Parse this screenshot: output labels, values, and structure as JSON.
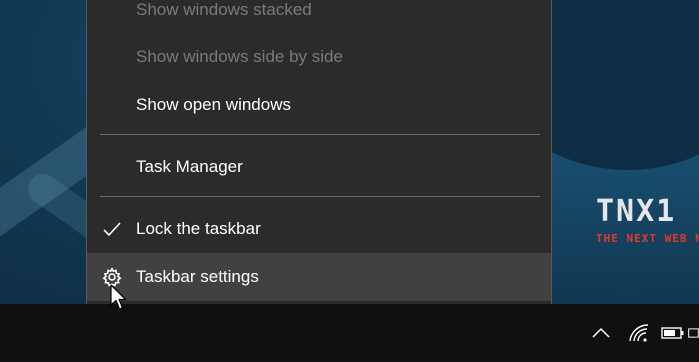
{
  "context_menu": {
    "items": [
      {
        "label": "Show windows stacked",
        "enabled": false
      },
      {
        "label": "Show windows side by side",
        "enabled": false
      },
      {
        "label": "Show open windows",
        "enabled": true
      },
      {
        "label": "Task Manager",
        "enabled": true
      },
      {
        "label": "Lock the taskbar",
        "enabled": true,
        "checked": true,
        "icon": "checkmark-icon"
      },
      {
        "label": "Taskbar settings",
        "enabled": true,
        "icon": "gear-icon",
        "hovered": true
      }
    ]
  },
  "wallpaper": {
    "logo_text": "TNX1",
    "logo_tagline": "THE NEXT WEB N"
  },
  "system_tray": {
    "icons": [
      "chevron-up-icon",
      "wifi-icon",
      "battery-icon",
      "action-center-icon"
    ]
  },
  "colors": {
    "menu_bg": "#2b2b2b",
    "menu_hover": "#414141",
    "taskbar_bg": "#101010",
    "disabled_text": "#7a7a7a",
    "accent_red": "#e0392b"
  }
}
